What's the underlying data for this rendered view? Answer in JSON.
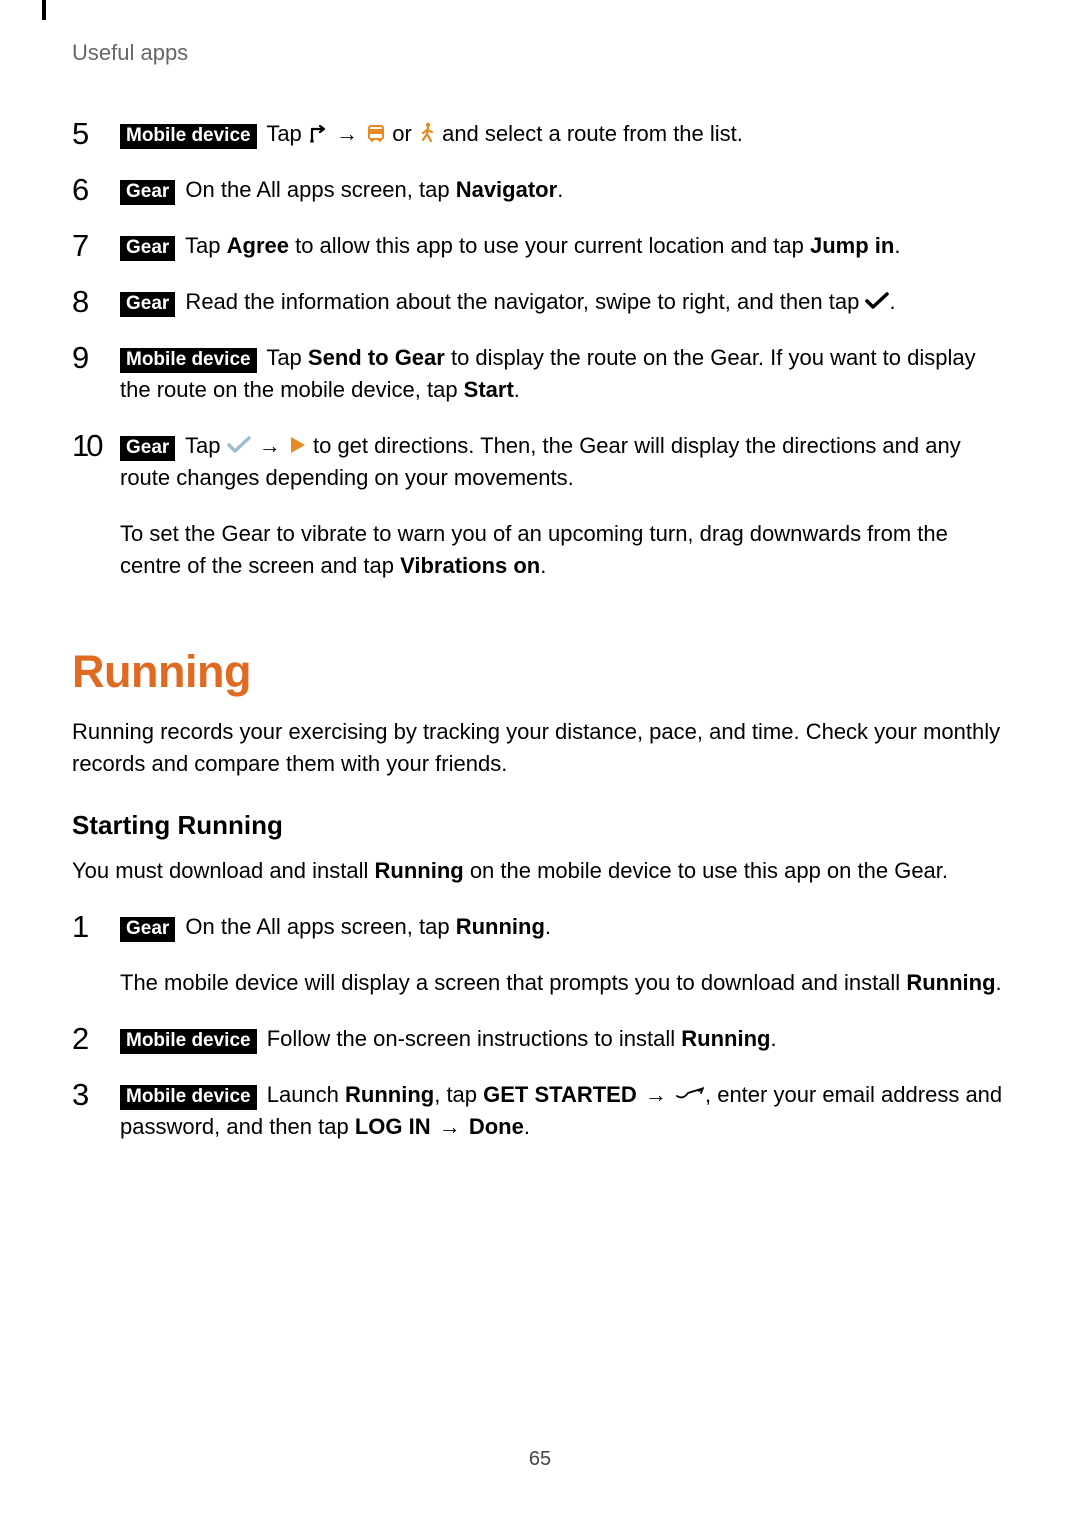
{
  "header": {
    "title": "Useful apps"
  },
  "badge": {
    "mobile": "Mobile device",
    "gear": "Gear"
  },
  "steps1": {
    "s5": {
      "num": "5",
      "t1": " Tap ",
      "t2": " or ",
      "t3": " and select a route from the list."
    },
    "s6": {
      "num": "6",
      "t1": " On the All apps screen, tap ",
      "navigator": "Navigator",
      "t2": "."
    },
    "s7": {
      "num": "7",
      "t1": " Tap ",
      "agree": "Agree",
      "t2": " to allow this app to use your current location and tap ",
      "jump": "Jump in",
      "t3": "."
    },
    "s8": {
      "num": "8",
      "t1": " Read the information about the navigator, swipe to right, and then tap ",
      "t2": "."
    },
    "s9": {
      "num": "9",
      "t1": " Tap ",
      "send": "Send to Gear",
      "t2": " to display the route on the Gear. If you want to display the route on the mobile device, tap ",
      "start": "Start",
      "t3": "."
    },
    "s10": {
      "num": "10",
      "t1": " Tap ",
      "t2": " to get directions. Then, the Gear will display the directions and any route changes depending on your movements.",
      "follow1": "To set the Gear to vibrate to warn you of an upcoming turn, drag downwards from the centre of the screen and tap ",
      "vib": "Vibrations on",
      "follow2": "."
    }
  },
  "running": {
    "title": "Running",
    "intro": "Running records your exercising by tracking your distance, pace, and time. Check your monthly records and compare them with your friends.",
    "subhead": "Starting Running",
    "must1": "You must download and install ",
    "mustB": "Running",
    "must2": " on the mobile device to use this app on the Gear.",
    "s1": {
      "num": "1",
      "t1": " On the All apps screen, tap ",
      "runb": "Running",
      "t2": ".",
      "follow1": "The mobile device will display a screen that prompts you to download and install ",
      "follow2": "."
    },
    "s2": {
      "num": "2",
      "t1": " Follow the on-screen instructions to install ",
      "runb": "Running",
      "t2": "."
    },
    "s3": {
      "num": "3",
      "t1": " Launch ",
      "runb": "Running",
      "t2": ", tap ",
      "get": "GET STARTED",
      "t3": ", enter your email address and password, and then tap ",
      "login": "LOG IN",
      "done": "Done",
      "t4": "."
    }
  },
  "arrow": "→",
  "page_number": "65"
}
